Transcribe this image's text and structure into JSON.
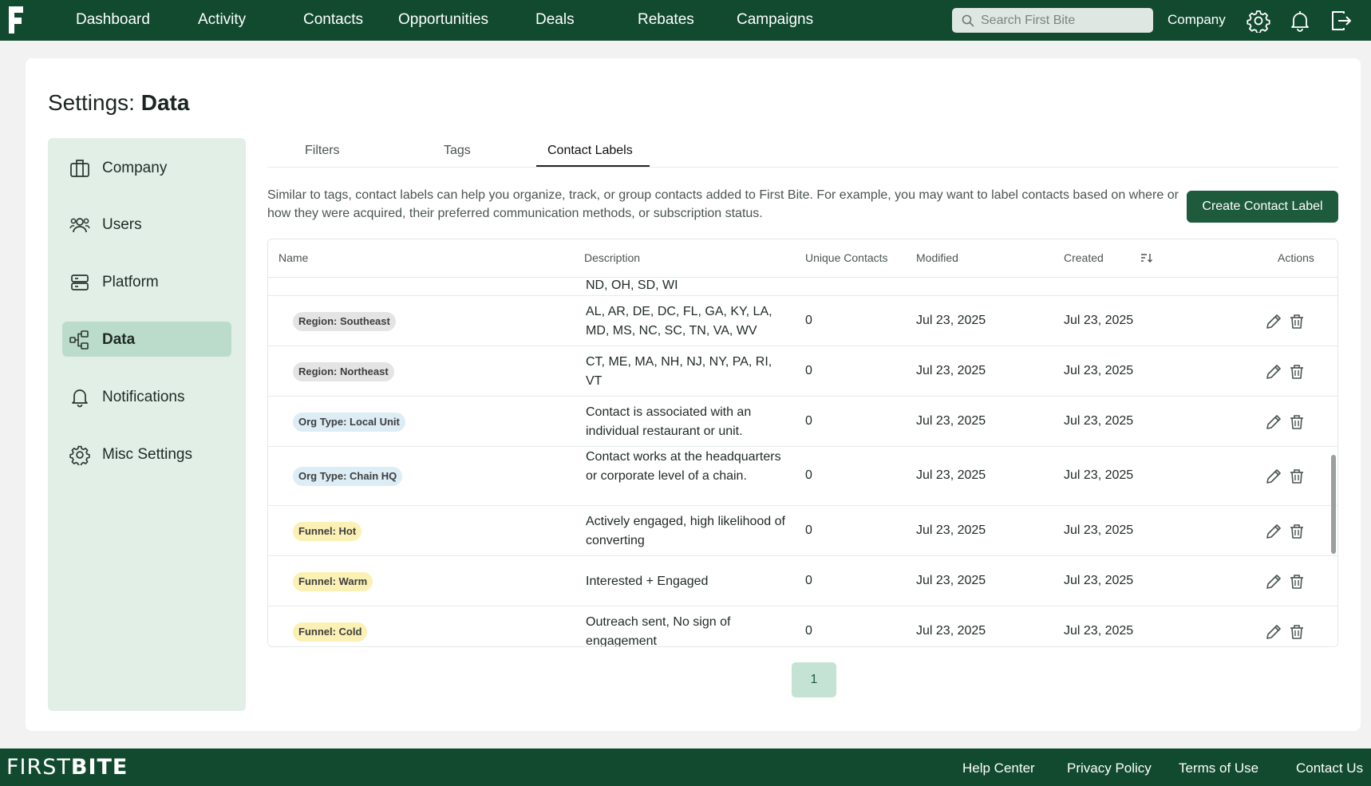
{
  "colors": {
    "brand_green": "#114a2f",
    "accent_green": "#1e5a3c",
    "sidebar_bg": "#e1efe7",
    "sidebar_active": "#bcdccb"
  },
  "nav": {
    "items": [
      "Dashboard",
      "Activity",
      "Contacts",
      "Opportunities",
      "Deals",
      "Rebates",
      "Campaigns"
    ],
    "search_placeholder": "Search First Bite",
    "company": "Company",
    "icons": [
      "gear-icon",
      "bell-icon",
      "logout-icon"
    ]
  },
  "page": {
    "title_prefix": "Settings:",
    "title_bold": "Data"
  },
  "sidebar": {
    "items": [
      {
        "label": "Company",
        "icon": "building-icon"
      },
      {
        "label": "Users",
        "icon": "users-icon"
      },
      {
        "label": "Platform",
        "icon": "server-icon"
      },
      {
        "label": "Data",
        "icon": "data-flow-icon",
        "active": true
      },
      {
        "label": "Notifications",
        "icon": "bell-icon"
      },
      {
        "label": "Misc Settings",
        "icon": "gear-icon"
      }
    ]
  },
  "tabs": [
    "Filters",
    "Tags",
    "Contact Labels"
  ],
  "active_tab": "Contact Labels",
  "intro": "Similar to tags, contact labels can help you organize, track, or group contacts added to First Bite. For example, you may want to label contacts based on where or how they were acquired, their preferred communication methods, or subscription status.",
  "create_button": "Create Contact Label",
  "table": {
    "columns": [
      "Name",
      "Description",
      "Unique Contacts",
      "Modified",
      "Created",
      "Actions"
    ],
    "partial_row_desc": "ND, OH, SD, WI",
    "rows": [
      {
        "name": "Region: Southeast",
        "badge_color": "#e4e4e4",
        "description": "AL, AR, DE, DC, FL, GA, KY, LA, MD, MS, NC, SC, TN, VA, WV",
        "unique": "0",
        "modified": "Jul 23, 2025",
        "created": "Jul 23, 2025"
      },
      {
        "name": "Region: Northeast",
        "badge_color": "#e4e4e4",
        "description": "CT, ME, MA, NH, NJ, NY, PA, RI, VT",
        "unique": "0",
        "modified": "Jul 23, 2025",
        "created": "Jul 23, 2025"
      },
      {
        "name": "Org Type: Local Unit",
        "badge_color": "#dcedf6",
        "description": "Contact is associated with an individual restaurant or unit.",
        "unique": "0",
        "modified": "Jul 23, 2025",
        "created": "Jul 23, 2025"
      },
      {
        "name": "Org Type: Chain HQ",
        "badge_color": "#dcedf6",
        "description": "Contact works at the headquarters or corporate level of a chain.",
        "unique": "0",
        "modified": "Jul 23, 2025",
        "created": "Jul 23, 2025"
      },
      {
        "name": "Funnel: Hot",
        "badge_color": "#fbf1b5",
        "description": "Actively engaged, high likelihood of converting",
        "unique": "0",
        "modified": "Jul 23, 2025",
        "created": "Jul 23, 2025"
      },
      {
        "name": "Funnel: Warm",
        "badge_color": "#fbf1b5",
        "description": "Interested + Engaged",
        "unique": "0",
        "modified": "Jul 23, 2025",
        "created": "Jul 23, 2025"
      },
      {
        "name": "Funnel: Cold",
        "badge_color": "#fbf1b5",
        "description": "Outreach sent, No sign of engagement",
        "unique": "0",
        "modified": "Jul 23, 2025",
        "created": "Jul 23, 2025"
      }
    ]
  },
  "pagination": {
    "current": "1"
  },
  "footer": {
    "brand_light": "FIRST",
    "brand_bold": "BITE",
    "links": [
      "Help Center",
      "Privacy Policy",
      "Terms of Use",
      "Contact Us"
    ]
  }
}
